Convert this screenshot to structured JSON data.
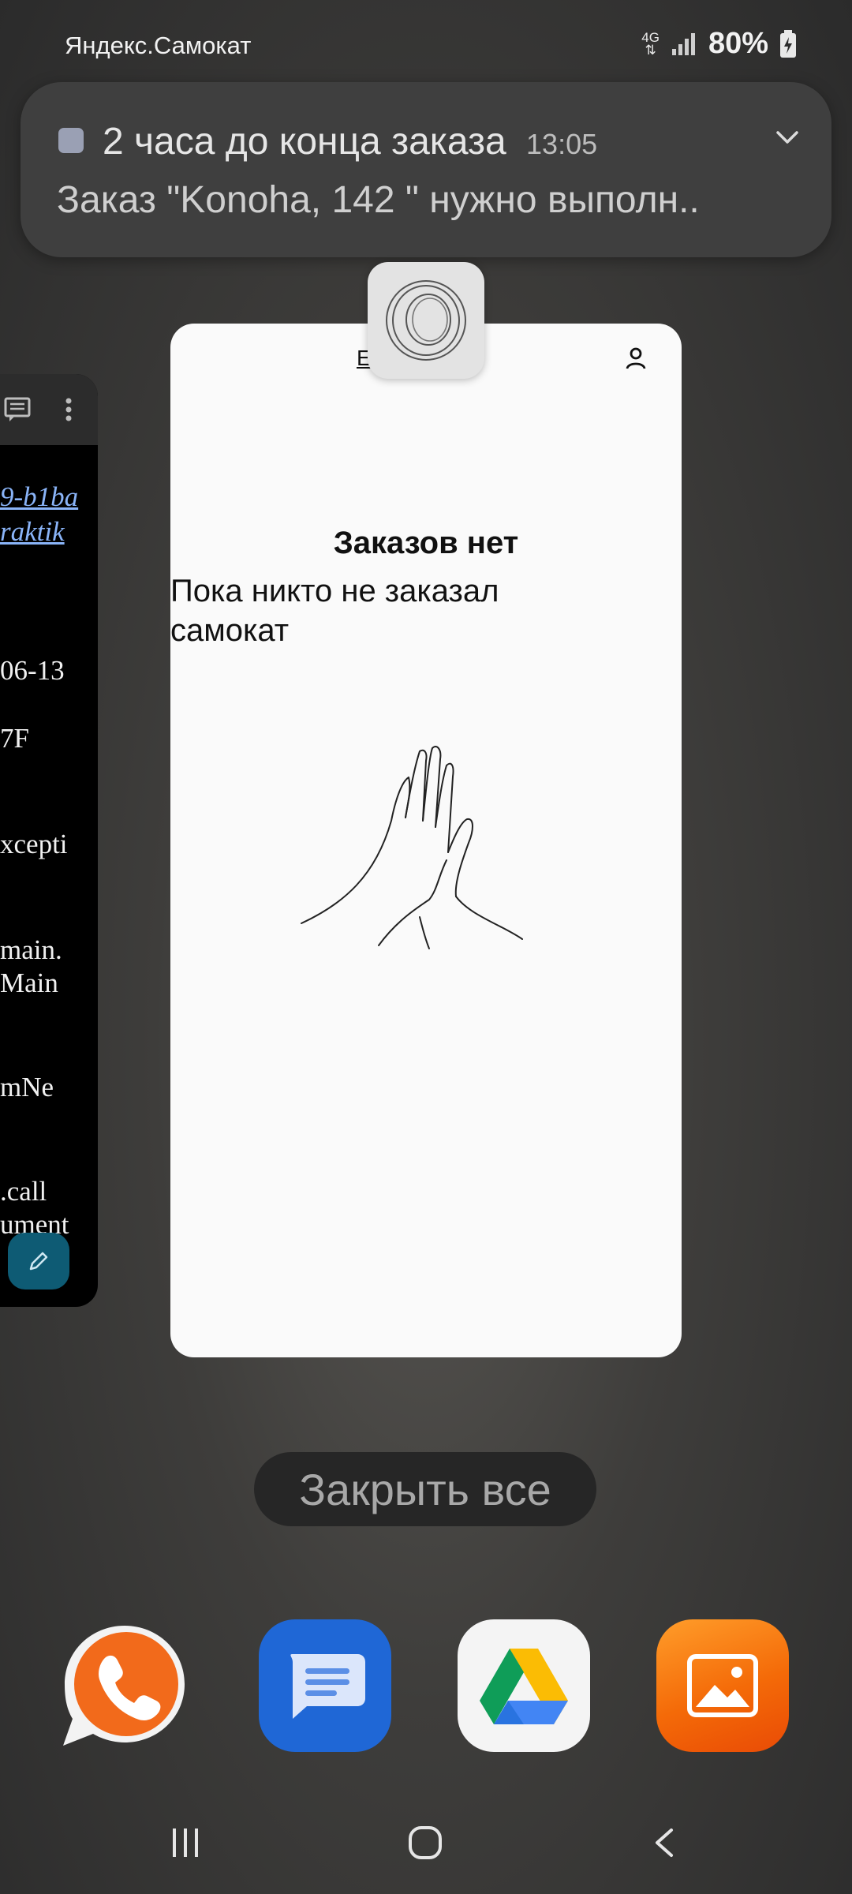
{
  "status_bar": {
    "app_name": "Яндекс.Самокат",
    "network": "4G",
    "battery": "80%"
  },
  "notification": {
    "title": "2 часа до конца заказа",
    "time": "13:05",
    "text": "Заказ \"Konoha, 142 \" нужно выполн.."
  },
  "left_card": {
    "lines": [
      "9-b1ba",
      "raktik",
      "06-13",
      "7F",
      "xcepti",
      "main.",
      "Main",
      "mNe",
      ".call",
      "ument"
    ]
  },
  "app_card": {
    "header_partial": "E",
    "empty_title": "Заказов нет",
    "empty_subtitle": "Пока никто не заказал самокат"
  },
  "close_all_label": "Закрыть все",
  "dock": {
    "apps": [
      "phone",
      "messages",
      "google-drive",
      "gallery"
    ]
  },
  "colors": {
    "messages": "#1f67d6",
    "gallery": "#f46a08",
    "phone": "#f26a1b",
    "edit_fab": "#0e5b74"
  }
}
